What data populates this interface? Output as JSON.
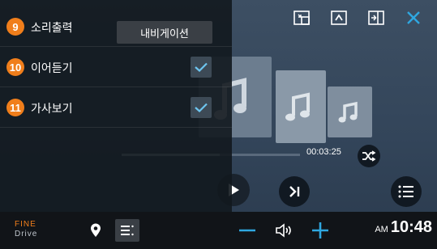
{
  "options_panel": {
    "rows": [
      {
        "number": "9",
        "label": "소리출력",
        "control": "button",
        "button_label": "내비게이션"
      },
      {
        "number": "10",
        "label": "이어듣기",
        "control": "checkbox",
        "checked": true
      },
      {
        "number": "11",
        "label": "가사보기",
        "control": "checkbox",
        "checked": true
      }
    ]
  },
  "player": {
    "elapsed_time": "00:03:25"
  },
  "bottom_bar": {
    "logo_top": "FINE",
    "logo_bottom": "Drive",
    "clock_ampm": "AM",
    "clock_time": "10:48"
  },
  "icons": {
    "topbar": [
      "screen-resize-icon",
      "collapse-icon",
      "exit-icon",
      "close-icon"
    ],
    "player": [
      "music-note-icon",
      "shuffle-icon",
      "play-icon",
      "next-track-icon",
      "list-icon"
    ],
    "bottom": [
      "map-pin-icon",
      "menu-icon",
      "volume-down-icon",
      "speaker-icon",
      "volume-up-icon"
    ]
  },
  "colors": {
    "accent": "#f07e1b",
    "close": "#2fa7e0",
    "volume": "#2fa7e0",
    "check": "#6ec6f0"
  },
  "progress_fraction": 0.55
}
